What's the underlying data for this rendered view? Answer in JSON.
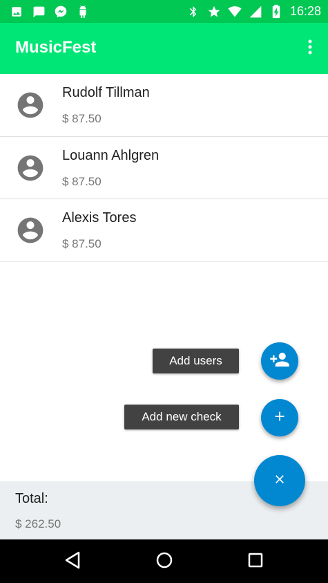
{
  "status_bar": {
    "time": "16:28",
    "left_icons": [
      "image-icon",
      "chat-icon",
      "messenger-icon",
      "android-icon"
    ],
    "right_icons": [
      "bluetooth-icon",
      "star-icon",
      "wifi-icon",
      "signal-icon",
      "battery-charging-icon"
    ]
  },
  "app_bar": {
    "title": "MusicFest",
    "overflow_icon": "more-vert-icon"
  },
  "list": {
    "items": [
      {
        "name": "Rudolf Tillman",
        "amount": "$ 87.50"
      },
      {
        "name": "Louann Ahlgren",
        "amount": "$ 87.50"
      },
      {
        "name": "Alexis Tores",
        "amount": "$ 87.50"
      }
    ]
  },
  "fab_menu": {
    "add_users_label": "Add users",
    "add_check_label": "Add new check",
    "close_icon": "close-icon"
  },
  "footer": {
    "label": "Total:",
    "amount": "$ 262.50"
  },
  "colors": {
    "status_bar": "#00C853",
    "app_bar": "#00E676",
    "fab": "#0288D1",
    "footer": "#ECEFF1",
    "fab_label": "#424242"
  }
}
